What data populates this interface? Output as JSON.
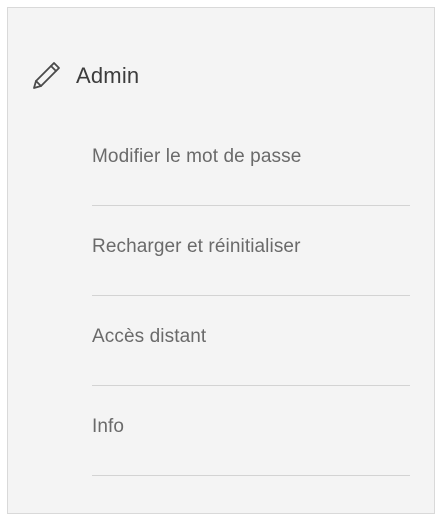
{
  "header": {
    "icon": "pencil-icon",
    "title": "Admin"
  },
  "menu": {
    "items": [
      {
        "label": "Modifier le mot de passe"
      },
      {
        "label": "Recharger et réinitialiser"
      },
      {
        "label": "Accès distant"
      },
      {
        "label": "Info"
      }
    ]
  },
  "colors": {
    "background": "#f4f4f4",
    "border": "#d9d9d9",
    "text": "#6a6a6a",
    "title": "#3c3c3c"
  }
}
